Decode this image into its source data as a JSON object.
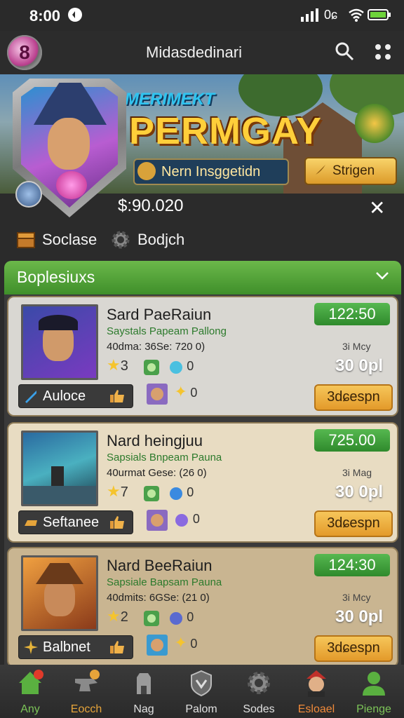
{
  "status": {
    "time": "8:00",
    "network": "0ɕ"
  },
  "app": {
    "title": "Midasdedinari",
    "logo_letter": "8"
  },
  "banner": {
    "heading_small": "MERIMEKT",
    "heading_large": "PERMGAY",
    "badge_text": "Nern Insggetidn",
    "action_label": "Strigen"
  },
  "profile": {
    "balance": "$:90.020"
  },
  "filters": [
    {
      "label": "Soclase",
      "icon": "chest-icon"
    },
    {
      "label": "Bodjch",
      "icon": "gear-icon"
    }
  ],
  "section": {
    "title": "Boplesiuxs"
  },
  "items": [
    {
      "name": "Sard PaeRaiun",
      "subtitle": "Saystals Papeam Pallong",
      "meta": "40dma: 36Se: 720 0)",
      "stars": "3",
      "badge_count": "0",
      "row2_count": "0",
      "price": "122:50",
      "price_note": "3i Mcy",
      "amount": "30 0pl",
      "action": "3dɕespn",
      "tag_label": "Auloce",
      "bg": "#d9d7d2"
    },
    {
      "name": "Nard heingjuu",
      "subtitle": "Sapsials Bnpeam Pauna",
      "meta": "40urmat Gese: (26 0)",
      "stars": "7",
      "badge_count": "0",
      "row2_count": "0",
      "price": "725.00",
      "price_note": "3i Mag",
      "amount": "30 0pl",
      "action": "3dɕespn",
      "tag_label": "Seftanee",
      "bg": "#e8dcc2"
    },
    {
      "name": "Nard BeeRaiun",
      "subtitle": "Sapsiale Bapsam Pauna",
      "meta": "40dmits: 6GSe: (21 0)",
      "stars": "2",
      "badge_count": "0",
      "row2_count": "0",
      "price": "124:30",
      "price_note": "3i Mcy",
      "amount": "30 0pl",
      "action": "3dɕespn",
      "tag_label": "Balbnet",
      "bg": "#c9b591"
    }
  ],
  "nav": [
    {
      "label": "Any",
      "icon": "home-icon",
      "color": "#7cc458"
    },
    {
      "label": "Eocch",
      "icon": "anvil-icon",
      "color": "#e6a43a"
    },
    {
      "label": "Nag",
      "icon": "tower-icon",
      "color": "#ffffff"
    },
    {
      "label": "Palom",
      "icon": "shield-icon",
      "color": "#ffffff"
    },
    {
      "label": "Sodes",
      "icon": "gear-icon",
      "color": "#ffffff"
    },
    {
      "label": "Esloael",
      "icon": "hero-avatar-icon",
      "color": "#f08a3a"
    },
    {
      "label": "Pienge",
      "icon": "person-icon",
      "color": "#7cc458"
    }
  ]
}
